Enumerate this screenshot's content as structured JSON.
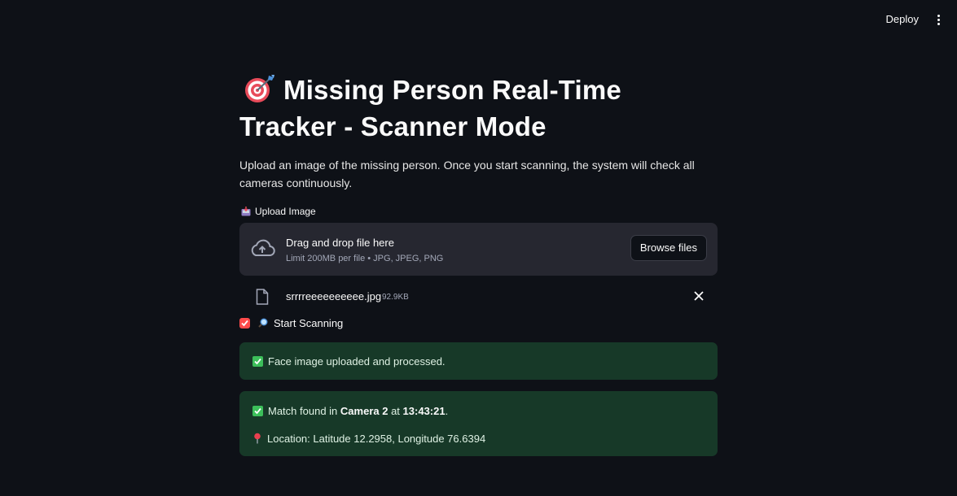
{
  "header": {
    "deploy_label": "Deploy",
    "menu_icon": "kebab-menu-icon"
  },
  "page": {
    "title_icon": "dart-target-icon",
    "title_line1": "Missing Person Real-Time",
    "title_line2": "Tracker - Scanner Mode",
    "description": "Upload an image of the missing person. Once you start scanning, the system will check all cameras continuously."
  },
  "uploader": {
    "label_icon": "inbox-tray-icon",
    "label": "Upload Image",
    "drop_title": "Drag and drop file here",
    "drop_limit": "Limit 200MB per file • JPG, JPEG, PNG",
    "browse_label": "Browse files",
    "file": {
      "name": "srrrreeeeeeeeee.jpg",
      "size": "92.9KB"
    }
  },
  "scan_toggle": {
    "checked": true,
    "icon": "magnifying-glass-icon",
    "label": "Start Scanning"
  },
  "alerts": {
    "processed": "Face image uploaded and processed.",
    "match_prefix": "Match found in",
    "match_camera": "Camera 2",
    "match_at": "at",
    "match_time": "13:43:21",
    "match_suffix": ".",
    "location": "Location: Latitude 12.2958, Longitude 76.6394"
  },
  "colors": {
    "background": "#0e1117",
    "surface": "#262730",
    "accent": "#ff4b4b",
    "success_bg": "#173928",
    "success_icon": "#3cbf5a"
  }
}
